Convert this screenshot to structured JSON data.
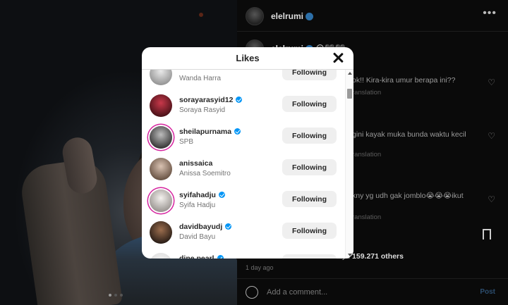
{
  "post": {
    "author": "elelrumi",
    "caption_author": "elelrumi",
    "caption_emojis": "😢🖤🖤",
    "more_icon": "ellipsis-icon",
    "comments": [
      {
        "text": "ok!! Kira-kira umur berapa ini??",
        "translation": "ranslation"
      },
      {
        "text": "gini kayak muka bunda waktu kecil",
        "translation": "ranslation"
      },
      {
        "text": "kny yg udh gak jomblo😭😭😭ikut",
        "translation": "ranslation"
      }
    ],
    "likes_text": "yd",
    "likes_count": "159.271 others",
    "date": "1 day ago",
    "add_comment_placeholder": "Add a comment...",
    "post_button": "Post"
  },
  "modal": {
    "title": "Likes",
    "close_icon": "close-icon",
    "users": [
      {
        "username": "",
        "fullname": "Wanda Harra",
        "verified": false,
        "button": "Following",
        "ring": false,
        "avatar": [
          "#e9e9e9",
          "#8b8b8b"
        ]
      },
      {
        "username": "sorayarasyid12",
        "fullname": "Soraya Rasyid",
        "verified": true,
        "button": "Following",
        "ring": false,
        "avatar": [
          "#c8384a",
          "#3b0d12"
        ]
      },
      {
        "username": "sheilapurnama",
        "fullname": "SPB",
        "verified": true,
        "button": "Following",
        "ring": true,
        "avatar": [
          "#bdbdbd",
          "#262626"
        ]
      },
      {
        "username": "anissaica",
        "fullname": "Anissa Soemitro",
        "verified": false,
        "button": "Following",
        "ring": false,
        "avatar": [
          "#d9c2b2",
          "#5b4536"
        ]
      },
      {
        "username": "syifahadju",
        "fullname": "Syifa Hadju",
        "verified": true,
        "button": "Following",
        "ring": true,
        "avatar": [
          "#f4f1ee",
          "#8f8a86"
        ]
      },
      {
        "username": "davidbayudj",
        "fullname": "David Bayu",
        "verified": true,
        "button": "Following",
        "ring": false,
        "avatar": [
          "#9c6e4e",
          "#1c1410"
        ]
      },
      {
        "username": "dine.pearl",
        "fullname": "",
        "verified": true,
        "button": "Following",
        "ring": false,
        "avatar": [
          "#f2f2f2",
          "#d8d8d8"
        ]
      }
    ]
  },
  "colors": {
    "verified": "#0095f6",
    "story_ring": "#d6249f",
    "button_bg": "#efefef"
  }
}
